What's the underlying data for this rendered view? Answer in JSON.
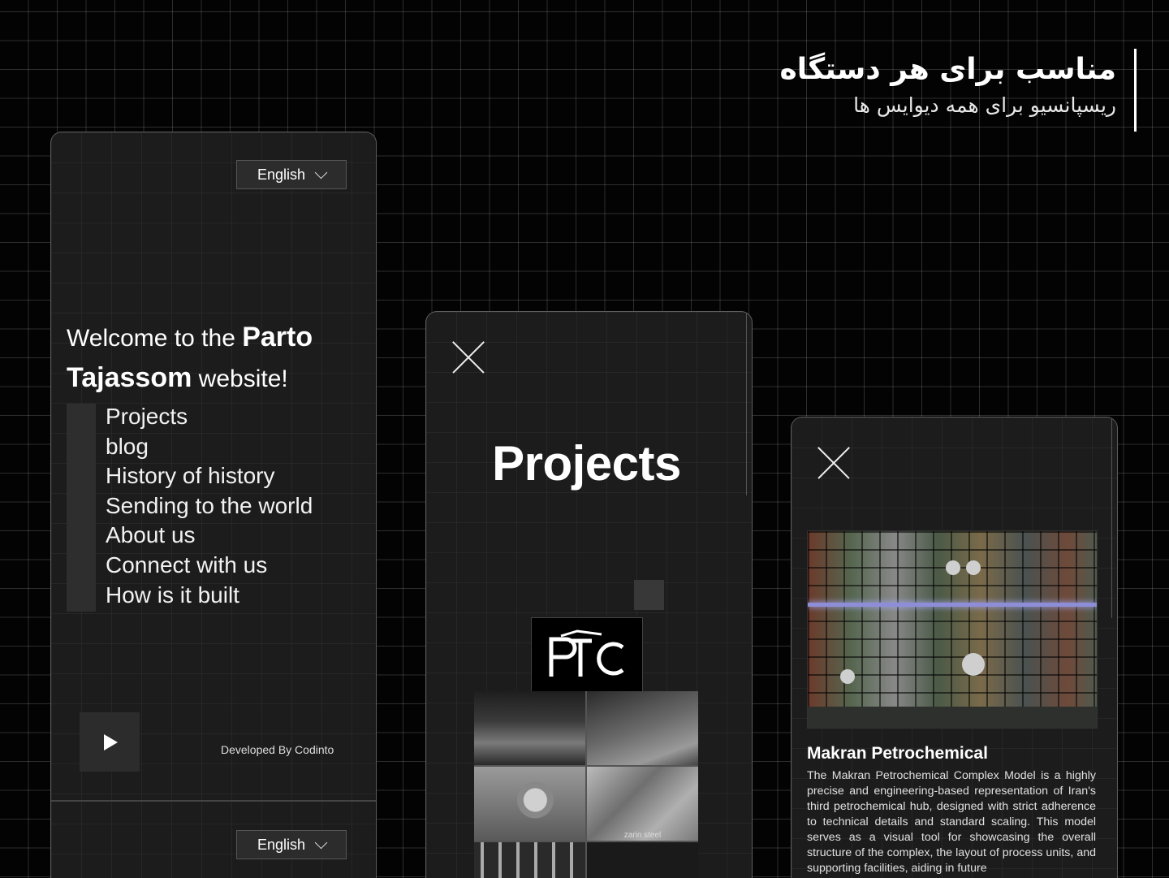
{
  "headline": {
    "title": "مناسب برای هر دستگاه",
    "subtitle": "ریسپانسیو برای همه دیوایس ها"
  },
  "menu_screen": {
    "language": "English",
    "welcome_prefix": "Welcome to the ",
    "welcome_brand": "Parto Tajassom",
    "welcome_suffix": " website!",
    "nav": [
      "Projects",
      "blog",
      "History of history",
      "Sending to the world",
      "About us",
      "Connect with us",
      "How is it built"
    ],
    "developer_credit": "Developed By Codinto",
    "language_repeat": "English"
  },
  "projects_screen": {
    "title": "Projects",
    "logo_text": "PTC",
    "photo_caption": "zarin steel"
  },
  "detail_screen": {
    "project_name": "Makran Petrochemical",
    "description": "The Makran Petrochemical Complex Model is a highly precise and engineering-based representation of Iran's third petrochemical hub, designed with strict adherence to technical details and standard scaling. This model serves as a visual tool for showcasing the overall structure of the complex, the layout of process units, and supporting facilities, aiding in future"
  },
  "icons": {
    "language_dropdown": "chevron-down-icon",
    "play": "play-icon",
    "close": "close-icon"
  },
  "colors": {
    "background": "#030303",
    "panel": "#1c1c1c",
    "text": "#ffffff"
  }
}
